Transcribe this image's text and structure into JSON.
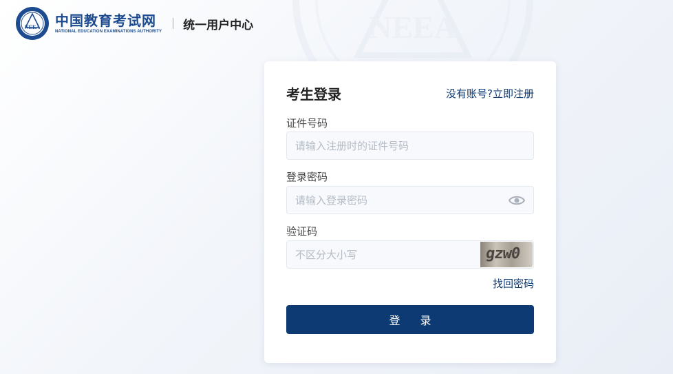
{
  "brand": {
    "name_cn": "中国教育考试网",
    "name_en": "NATIONAL EDUCATION EXAMINATIONS AUTHORITY",
    "emblem_letters": "NEEA",
    "portal_title": "统一用户中心",
    "color": "#1d4b8f"
  },
  "login": {
    "title": "考生登录",
    "register_link": "没有账号?立即注册",
    "id_label": "证件号码",
    "id_placeholder": "请输入注册时的证件号码",
    "password_label": "登录密码",
    "password_placeholder": "请输入登录密码",
    "password_toggle_icon": "eye-icon",
    "captcha_label": "验证码",
    "captcha_placeholder": "不区分大小写",
    "captcha_text": "gzw0",
    "forgot_link": "找回密码",
    "submit_label": "登 录",
    "accent_color": "#0e3a73"
  }
}
